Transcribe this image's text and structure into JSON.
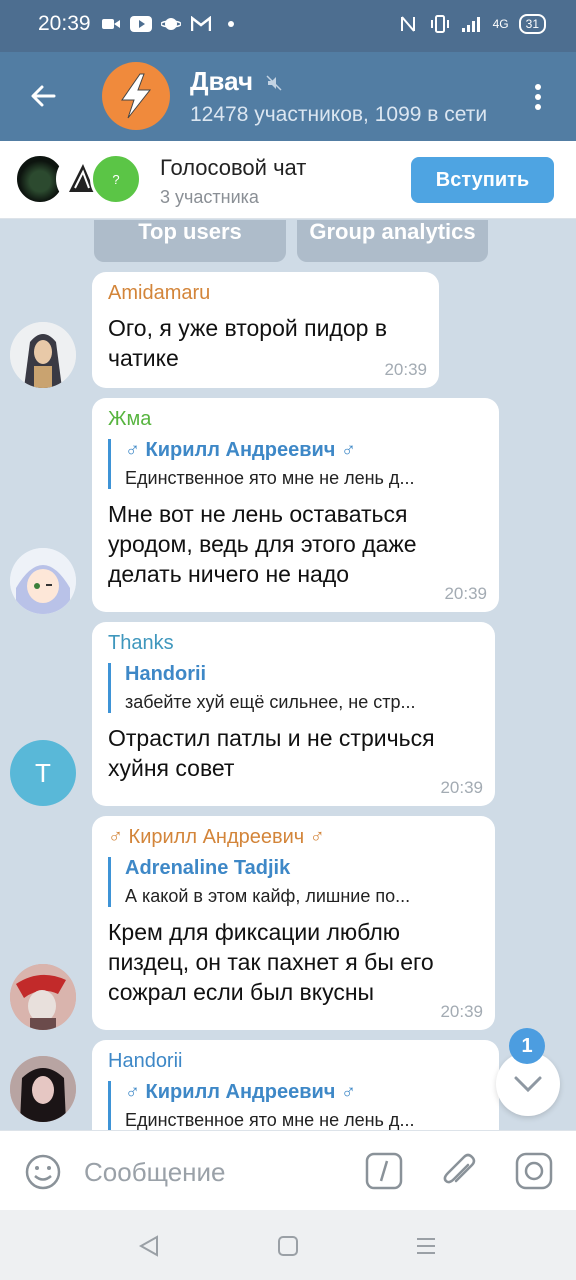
{
  "status_bar": {
    "time": "20:39",
    "battery": "31",
    "network": "4G"
  },
  "header": {
    "title": "Двач",
    "subtitle": "12478 участников, 1099 в сети"
  },
  "voice_chat": {
    "title": "Голосовой чат",
    "subtitle": "3 участника",
    "join_label": "Вступить",
    "avatar3_text": "?"
  },
  "keyboard": {
    "btn1": "Top users",
    "btn2": "Group analytics"
  },
  "messages": [
    {
      "sender": "Amidamaru",
      "sender_color": "#d3853a",
      "text_lines": [
        "Ого, я уже второй пидор в",
        "чатике"
      ],
      "time": "20:39"
    },
    {
      "sender": "Жма",
      "sender_color": "#57b43f",
      "reply_name": "♂ Кирилл Андреевич ♂",
      "reply_text": "Единственное ято мне не лень д...",
      "text_lines": [
        "Мне вот не лень оставаться",
        "уродом, ведь для этого даже",
        "делать ничего не надо"
      ],
      "time": "20:39"
    },
    {
      "sender": "Thanks",
      "sender_color": "#3f97bd",
      "avatar_letter": "T",
      "reply_name": "Handorii",
      "reply_text": "забейте хуй ещё сильнее, не стр...",
      "text_lines": [
        "Отрастил патлы и не стричься",
        "хуйня совет"
      ],
      "time": "20:39"
    },
    {
      "sender": "♂ Кирилл Андреевич ♂",
      "sender_color": "#d3853a",
      "reply_name": "Adrenaline Tadjik",
      "reply_text": "А какой в этом кайф, лишние по...",
      "text_lines": [
        "Крем для фиксации люблю",
        "пиздец, он так пахнет я бы его",
        "сожрал если был вкусны"
      ],
      "time": "20:39"
    },
    {
      "sender": "Handorii",
      "sender_color": "#3e88c7",
      "reply_name": "♂ Кирилл Андреевич ♂",
      "reply_text": "Единственное ято мне не лень д..."
    }
  ],
  "input": {
    "placeholder": "Сообщение"
  },
  "scroll_badge": "1"
}
